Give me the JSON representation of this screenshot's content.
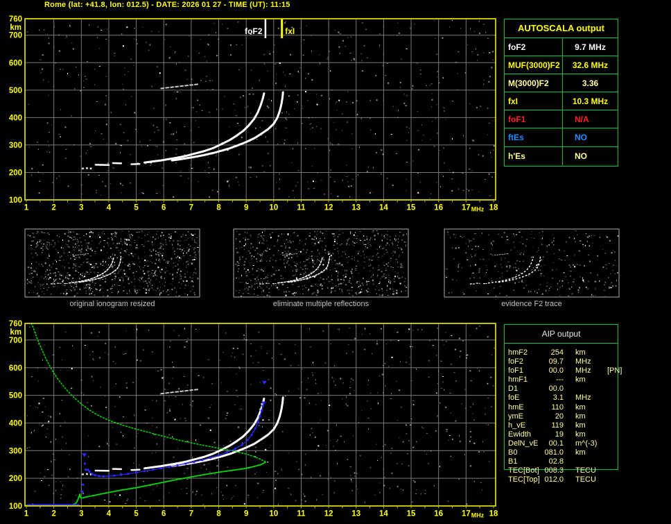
{
  "title": "Rome (lat: +41.8, lon: 012.5) - DATE: 2026 01 27 - TIME (UT): 11:15",
  "colors": {
    "background": "#000000",
    "title": "#ffff00",
    "plot_border": "#f0f000",
    "grid": "#7a7a7a",
    "axis_label": "#ffff00",
    "trace_white": "#ffffff",
    "oblique_echo": "#c8c8c8",
    "profile_green": "#00dd00",
    "restored_blue": "#2a2aff",
    "table_border": "#00c848",
    "thumb_border": "#b0b0b0",
    "caption": "#c4c4c4",
    "aip_text": "#ffff9b",
    "aip_header": "#e8e8e8",
    "fof2_marker": "#ffffff",
    "fxi_marker": "#ffff00"
  },
  "autoscala_table": {
    "title": "AUTOSCALA output",
    "rows": [
      {
        "label": "foF2",
        "value": "9.7 MHz",
        "color": "#ffffff",
        "align": "center"
      },
      {
        "label": "MUF(3000)F2",
        "value": "32.6 MHz",
        "color": "#ffff00",
        "align": "center"
      },
      {
        "label": "M(3000)F2",
        "value": "3.36",
        "color": "#ffff9b",
        "align": "center"
      },
      {
        "label": "fxI",
        "value": "10.3 MHz",
        "color": "#ffff00",
        "align": "center"
      },
      {
        "label": "foF1",
        "value": "N/A",
        "color": "#ff2222",
        "align": "left"
      },
      {
        "label": "ftEs",
        "value": "NO",
        "color": "#1e90ff",
        "align": "left"
      },
      {
        "label": "h'Es",
        "value": "NO",
        "color": "#ffff9b",
        "align": "left"
      }
    ]
  },
  "aip_table": {
    "title": "AIP output",
    "rows": [
      {
        "label": "hmF2",
        "value": "254",
        "unit": "km",
        "note": ""
      },
      {
        "label": "foF2",
        "value": "09.7",
        "unit": "MHz",
        "note": ""
      },
      {
        "label": "foF1",
        "value": "00.0",
        "unit": "MHz",
        "note": "[PN]"
      },
      {
        "label": "hmF1",
        "value": "---",
        "unit": "km",
        "note": ""
      },
      {
        "label": "D1",
        "value": "00.0",
        "unit": "",
        "note": ""
      },
      {
        "label": "foE",
        "value": "3.1",
        "unit": "MHz",
        "note": ""
      },
      {
        "label": "hmE",
        "value": "110",
        "unit": "km",
        "note": ""
      },
      {
        "label": "ymE",
        "value": "20",
        "unit": "km",
        "note": ""
      },
      {
        "label": "h_vE",
        "value": "119",
        "unit": "km",
        "note": ""
      },
      {
        "label": "Ewidth",
        "value": "19",
        "unit": "km",
        "note": ""
      },
      {
        "label": "DelN_vE",
        "value": "00.1",
        "unit": "m^(-3)",
        "note": ""
      },
      {
        "label": "B0",
        "value": "081.0",
        "unit": "km",
        "note": ""
      },
      {
        "label": "B1",
        "value": "02.8",
        "unit": "",
        "note": ""
      },
      {
        "label": "TEC[Bot]",
        "value": "008.3",
        "unit": "TECU",
        "note": ""
      },
      {
        "label": "TEC[Top]",
        "value": "012.0",
        "unit": "TECU",
        "note": ""
      }
    ]
  },
  "thumbnails": [
    {
      "caption": "original ionogram resized",
      "noise_seed": 5,
      "noise_count": 900,
      "dash": "2.5 2"
    },
    {
      "caption": "eliminate multiple reflections",
      "noise_seed": 6,
      "noise_count": 780,
      "dash": "2.5 2"
    },
    {
      "caption": "evidence F2 trace",
      "noise_seed": 7,
      "noise_count": 330,
      "dash": "1.5 3.5"
    }
  ],
  "chart_data": {
    "type": "scatter",
    "axis": {
      "x_unit": "MHz",
      "y_unit": "km",
      "x_range": [
        1,
        18
      ],
      "y_range": [
        100,
        760
      ],
      "x_ticks": [
        1,
        2,
        3,
        4,
        5,
        6,
        7,
        8,
        9,
        10,
        11,
        12,
        13,
        14,
        15,
        16,
        17,
        18
      ],
      "y_ticks": [
        760,
        700,
        600,
        500,
        400,
        300,
        200,
        100
      ]
    },
    "markers": [
      {
        "label": "foF2",
        "x": 9.7,
        "color": "#ffffff"
      },
      {
        "label": "fxI",
        "x": 10.3,
        "color": "#ffff00"
      }
    ],
    "ionogram": {
      "o_dots": [
        [
          3.05,
          215
        ],
        [
          3.2,
          216
        ],
        [
          3.34,
          215
        ]
      ],
      "o_segments": [
        [
          [
            3.52,
            228
          ],
          [
            4.0,
            227
          ]
        ],
        [
          [
            4.15,
            234
          ],
          [
            4.45,
            233
          ]
        ],
        [
          [
            4.82,
            230
          ],
          [
            5.12,
            231
          ]
        ]
      ],
      "o_trace": [
        [
          5.3,
          236
        ],
        [
          5.6,
          240
        ],
        [
          5.9,
          244
        ],
        [
          6.2,
          249
        ],
        [
          6.5,
          254
        ],
        [
          6.8,
          260
        ],
        [
          7.1,
          268
        ],
        [
          7.45,
          277
        ],
        [
          7.8,
          289
        ],
        [
          8.1,
          303
        ],
        [
          8.4,
          318
        ],
        [
          8.65,
          334
        ],
        [
          8.9,
          352
        ],
        [
          9.1,
          372
        ],
        [
          9.28,
          394
        ],
        [
          9.42,
          418
        ],
        [
          9.52,
          443
        ],
        [
          9.6,
          468
        ],
        [
          9.65,
          488
        ]
      ],
      "x_trace": [
        [
          6.3,
          244
        ],
        [
          6.6,
          248
        ],
        [
          6.9,
          253
        ],
        [
          7.2,
          258
        ],
        [
          7.5,
          264
        ],
        [
          7.8,
          271
        ],
        [
          8.1,
          279
        ],
        [
          8.4,
          288
        ],
        [
          8.7,
          299
        ],
        [
          9.0,
          311
        ],
        [
          9.3,
          325
        ],
        [
          9.55,
          341
        ],
        [
          9.8,
          358
        ],
        [
          10.0,
          377
        ],
        [
          10.13,
          399
        ],
        [
          10.22,
          423
        ],
        [
          10.28,
          448
        ],
        [
          10.32,
          472
        ],
        [
          10.34,
          492
        ]
      ],
      "oblique_echo": [
        [
          5.9,
          506
        ],
        [
          7.3,
          522
        ]
      ]
    },
    "profile_plot": {
      "restored_flat": {
        "f_start": 1.05,
        "f_end": 2.92,
        "km": 104,
        "step": 0.045
      },
      "restored_trace": [
        [
          3.24,
          231
        ],
        [
          3.3,
          224
        ],
        [
          3.4,
          215
        ],
        [
          3.5,
          211
        ],
        [
          3.65,
          208
        ],
        [
          3.8,
          207
        ],
        [
          4.0,
          208
        ],
        [
          4.2,
          210
        ],
        [
          4.45,
          213
        ],
        [
          4.7,
          216
        ],
        [
          5.0,
          221
        ],
        [
          5.3,
          226
        ],
        [
          5.6,
          231
        ],
        [
          5.9,
          236
        ],
        [
          6.2,
          241
        ],
        [
          6.5,
          247
        ],
        [
          6.8,
          253
        ],
        [
          7.1,
          259
        ],
        [
          7.4,
          266
        ],
        [
          7.7,
          274
        ],
        [
          8.0,
          283
        ],
        [
          8.3,
          294
        ],
        [
          8.6,
          307
        ],
        [
          8.85,
          321
        ],
        [
          9.05,
          338
        ],
        [
          9.2,
          357
        ],
        [
          9.33,
          380
        ],
        [
          9.43,
          404
        ],
        [
          9.5,
          425
        ],
        [
          9.56,
          445
        ],
        [
          9.6,
          462
        ]
      ],
      "restored_cusp_points": [
        [
          3.04,
          152
        ],
        [
          3.06,
          177
        ],
        [
          3.16,
          231
        ],
        [
          3.13,
          253
        ]
      ],
      "restored_triangles": [
        [
          3.11,
          283
        ],
        [
          9.63,
          470
        ],
        [
          9.66,
          545
        ]
      ],
      "green_bottomside": [
        [
          1.0,
          102
        ],
        [
          2.5,
          102
        ],
        [
          2.66,
          104
        ],
        [
          2.76,
          107
        ],
        [
          2.83,
          113
        ],
        [
          2.88,
          124
        ],
        [
          2.92,
          135
        ],
        [
          2.95,
          143
        ],
        [
          2.96,
          132
        ],
        [
          2.99,
          128
        ],
        [
          3.08,
          130
        ],
        [
          3.25,
          134
        ],
        [
          3.6,
          141
        ],
        [
          4.0,
          149
        ],
        [
          4.5,
          158
        ],
        [
          5.0,
          166
        ],
        [
          5.5,
          176
        ],
        [
          6.0,
          186
        ],
        [
          6.5,
          196
        ],
        [
          7.0,
          205
        ],
        [
          7.5,
          214
        ],
        [
          8.0,
          222
        ],
        [
          8.5,
          229
        ],
        [
          9.0,
          236
        ],
        [
          9.3,
          243
        ],
        [
          9.55,
          250
        ],
        [
          9.7,
          258
        ]
      ],
      "green_topside": [
        [
          9.7,
          258
        ],
        [
          9.55,
          268
        ],
        [
          9.3,
          278
        ],
        [
          9.0,
          288
        ],
        [
          8.55,
          298
        ],
        [
          8.1,
          307
        ],
        [
          7.6,
          316
        ],
        [
          7.1,
          326
        ],
        [
          6.6,
          337
        ],
        [
          6.1,
          349
        ],
        [
          5.6,
          362
        ],
        [
          5.1,
          375
        ],
        [
          4.7,
          386
        ],
        [
          4.35,
          397
        ],
        [
          4.05,
          408
        ],
        [
          3.75,
          421
        ],
        [
          3.5,
          434
        ],
        [
          3.25,
          450
        ],
        [
          3.05,
          465
        ],
        [
          2.85,
          482
        ],
        [
          2.65,
          500
        ],
        [
          2.48,
          518
        ],
        [
          2.3,
          540
        ],
        [
          2.12,
          562
        ],
        [
          1.97,
          585
        ],
        [
          1.83,
          610
        ],
        [
          1.7,
          635
        ],
        [
          1.58,
          662
        ],
        [
          1.45,
          692
        ],
        [
          1.33,
          722
        ],
        [
          1.24,
          748
        ],
        [
          1.18,
          760
        ]
      ]
    },
    "noise": {
      "top_plot": {
        "seed": 42,
        "count": 640,
        "white_frac": 0.1
      },
      "bottom_plot": {
        "seed": 77,
        "count": 660,
        "white_frac": 0.15
      }
    }
  }
}
